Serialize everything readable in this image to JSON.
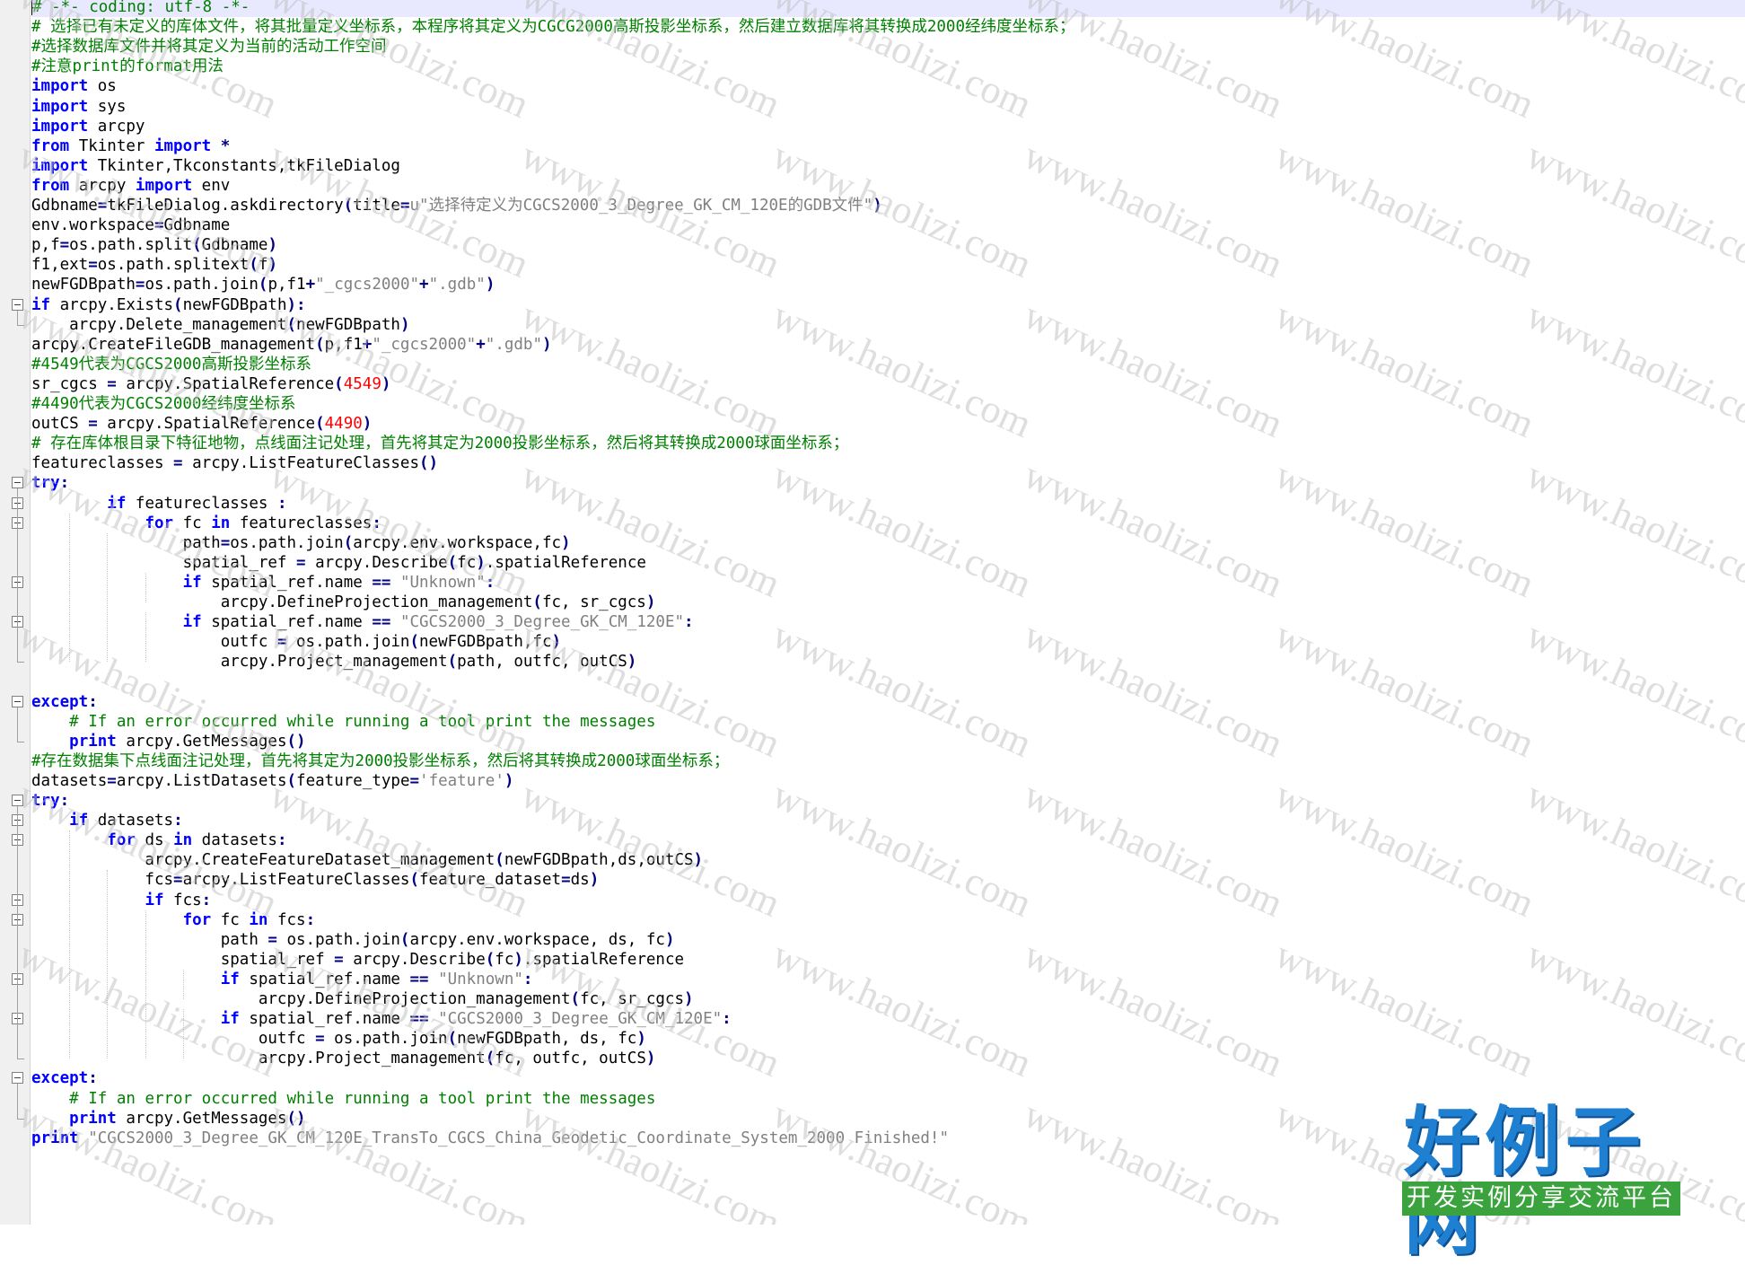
{
  "editor": {
    "language": "python",
    "lines": [
      [
        {
          "t": "cm",
          "v": "# -*- coding: utf-8 -*-"
        }
      ],
      [
        {
          "t": "cm",
          "v": "# 选择已有未定义的库体文件，将其批量定义坐标系，本程序将其定义为CGCG2000高斯投影坐标系，然后建立数据库将其转换成2000经纬度坐标系；"
        }
      ],
      [
        {
          "t": "cm",
          "v": "#选择数据库文件并将其定义为当前的活动工作空间"
        }
      ],
      [
        {
          "t": "cm",
          "v": "#注意print的format用法"
        }
      ],
      [
        {
          "t": "kw",
          "v": "import"
        },
        {
          "t": "tx",
          "v": " os"
        }
      ],
      [
        {
          "t": "kw",
          "v": "import"
        },
        {
          "t": "tx",
          "v": " sys"
        }
      ],
      [
        {
          "t": "kw",
          "v": "import"
        },
        {
          "t": "tx",
          "v": " arcpy"
        }
      ],
      [
        {
          "t": "kw",
          "v": "from"
        },
        {
          "t": "tx",
          "v": " Tkinter "
        },
        {
          "t": "kw",
          "v": "import"
        },
        {
          "t": "op",
          "v": " *"
        }
      ],
      [
        {
          "t": "kw",
          "v": "import"
        },
        {
          "t": "tx",
          "v": " Tkinter,Tkconstants,tkFileDialog"
        }
      ],
      [
        {
          "t": "kw",
          "v": "from"
        },
        {
          "t": "tx",
          "v": " arcpy "
        },
        {
          "t": "kw",
          "v": "import"
        },
        {
          "t": "tx",
          "v": " env"
        }
      ],
      [
        {
          "t": "tx",
          "v": "Gdbname"
        },
        {
          "t": "op",
          "v": "="
        },
        {
          "t": "tx",
          "v": "tkFileDialog.askdirectory"
        },
        {
          "t": "op",
          "v": "("
        },
        {
          "t": "tx",
          "v": "title"
        },
        {
          "t": "op",
          "v": "="
        },
        {
          "t": "st",
          "v": "u\"选择待定义为CGCS2000_3_Degree_GK_CM_120E的GDB文件\""
        },
        {
          "t": "op",
          "v": ")"
        }
      ],
      [
        {
          "t": "tx",
          "v": "env.workspace"
        },
        {
          "t": "op",
          "v": "="
        },
        {
          "t": "tx",
          "v": "Gdbname"
        }
      ],
      [
        {
          "t": "tx",
          "v": "p,f"
        },
        {
          "t": "op",
          "v": "="
        },
        {
          "t": "tx",
          "v": "os.path.split"
        },
        {
          "t": "op",
          "v": "("
        },
        {
          "t": "tx",
          "v": "Gdbname"
        },
        {
          "t": "op",
          "v": ")"
        }
      ],
      [
        {
          "t": "tx",
          "v": "f1,ext"
        },
        {
          "t": "op",
          "v": "="
        },
        {
          "t": "tx",
          "v": "os.path.splitext"
        },
        {
          "t": "op",
          "v": "("
        },
        {
          "t": "tx",
          "v": "f"
        },
        {
          "t": "op",
          "v": ")"
        }
      ],
      [
        {
          "t": "tx",
          "v": "newFGDBpath"
        },
        {
          "t": "op",
          "v": "="
        },
        {
          "t": "tx",
          "v": "os.path.join"
        },
        {
          "t": "op",
          "v": "("
        },
        {
          "t": "tx",
          "v": "p,f1"
        },
        {
          "t": "op",
          "v": "+"
        },
        {
          "t": "st",
          "v": "\"_cgcs2000\""
        },
        {
          "t": "op",
          "v": "+"
        },
        {
          "t": "st",
          "v": "\".gdb\""
        },
        {
          "t": "op",
          "v": ")"
        }
      ],
      [
        {
          "t": "kw",
          "v": "if"
        },
        {
          "t": "tx",
          "v": " arcpy.Exists"
        },
        {
          "t": "op",
          "v": "("
        },
        {
          "t": "tx",
          "v": "newFGDBpath"
        },
        {
          "t": "op",
          "v": "):"
        }
      ],
      [
        {
          "t": "tx",
          "v": "    arcpy.Delete_management"
        },
        {
          "t": "op",
          "v": "("
        },
        {
          "t": "tx",
          "v": "newFGDBpath"
        },
        {
          "t": "op",
          "v": ")"
        }
      ],
      [
        {
          "t": "tx",
          "v": "arcpy.CreateFileGDB_management"
        },
        {
          "t": "op",
          "v": "("
        },
        {
          "t": "tx",
          "v": "p,f1"
        },
        {
          "t": "op",
          "v": "+"
        },
        {
          "t": "st",
          "v": "\"_cgcs2000\""
        },
        {
          "t": "op",
          "v": "+"
        },
        {
          "t": "st",
          "v": "\".gdb\""
        },
        {
          "t": "op",
          "v": ")"
        }
      ],
      [
        {
          "t": "cm",
          "v": "#4549代表为CGCS2000高斯投影坐标系"
        }
      ],
      [
        {
          "t": "tx",
          "v": "sr_cgcs "
        },
        {
          "t": "op",
          "v": "="
        },
        {
          "t": "tx",
          "v": " arcpy.SpatialReference"
        },
        {
          "t": "op",
          "v": "("
        },
        {
          "t": "nm",
          "v": "4549"
        },
        {
          "t": "op",
          "v": ")"
        }
      ],
      [
        {
          "t": "cm",
          "v": "#4490代表为CGCS2000经纬度坐标系"
        }
      ],
      [
        {
          "t": "tx",
          "v": "outCS "
        },
        {
          "t": "op",
          "v": "="
        },
        {
          "t": "tx",
          "v": " arcpy.SpatialReference"
        },
        {
          "t": "op",
          "v": "("
        },
        {
          "t": "nm",
          "v": "4490"
        },
        {
          "t": "op",
          "v": ")"
        }
      ],
      [
        {
          "t": "cm",
          "v": "# 存在库体根目录下特征地物，点线面注记处理，首先将其定为2000投影坐标系，然后将其转换成2000球面坐标系；"
        }
      ],
      [
        {
          "t": "tx",
          "v": "featureclasses "
        },
        {
          "t": "op",
          "v": "="
        },
        {
          "t": "tx",
          "v": " arcpy.ListFeatureClasses"
        },
        {
          "t": "op",
          "v": "()"
        }
      ],
      [
        {
          "t": "kw",
          "v": "try"
        },
        {
          "t": "op",
          "v": ":"
        }
      ],
      [
        {
          "t": "tx",
          "v": "        "
        },
        {
          "t": "kw",
          "v": "if"
        },
        {
          "t": "tx",
          "v": " featureclasses "
        },
        {
          "t": "op",
          "v": ":"
        }
      ],
      [
        {
          "t": "tx",
          "v": "            "
        },
        {
          "t": "kw",
          "v": "for"
        },
        {
          "t": "tx",
          "v": " fc "
        },
        {
          "t": "kw",
          "v": "in"
        },
        {
          "t": "tx",
          "v": " featureclasses"
        },
        {
          "t": "op",
          "v": ":"
        }
      ],
      [
        {
          "t": "tx",
          "v": "                path"
        },
        {
          "t": "op",
          "v": "="
        },
        {
          "t": "tx",
          "v": "os.path.join"
        },
        {
          "t": "op",
          "v": "("
        },
        {
          "t": "tx",
          "v": "arcpy.env.workspace,fc"
        },
        {
          "t": "op",
          "v": ")"
        }
      ],
      [
        {
          "t": "tx",
          "v": "                spatial_ref "
        },
        {
          "t": "op",
          "v": "="
        },
        {
          "t": "tx",
          "v": " arcpy.Describe"
        },
        {
          "t": "op",
          "v": "("
        },
        {
          "t": "tx",
          "v": "fc"
        },
        {
          "t": "op",
          "v": ")"
        },
        {
          "t": "tx",
          "v": ".spatialReference"
        }
      ],
      [
        {
          "t": "tx",
          "v": "                "
        },
        {
          "t": "kw",
          "v": "if"
        },
        {
          "t": "tx",
          "v": " spatial_ref.name "
        },
        {
          "t": "op",
          "v": "=="
        },
        {
          "t": "tx",
          "v": " "
        },
        {
          "t": "st",
          "v": "\"Unknown\""
        },
        {
          "t": "op",
          "v": ":"
        }
      ],
      [
        {
          "t": "tx",
          "v": "                    arcpy.DefineProjection_management"
        },
        {
          "t": "op",
          "v": "("
        },
        {
          "t": "tx",
          "v": "fc, sr_cgcs"
        },
        {
          "t": "op",
          "v": ")"
        }
      ],
      [
        {
          "t": "tx",
          "v": "                "
        },
        {
          "t": "kw",
          "v": "if"
        },
        {
          "t": "tx",
          "v": " spatial_ref.name "
        },
        {
          "t": "op",
          "v": "=="
        },
        {
          "t": "tx",
          "v": " "
        },
        {
          "t": "st",
          "v": "\"CGCS2000_3_Degree_GK_CM_120E\""
        },
        {
          "t": "op",
          "v": ":"
        }
      ],
      [
        {
          "t": "tx",
          "v": "                    outfc "
        },
        {
          "t": "op",
          "v": "="
        },
        {
          "t": "tx",
          "v": " os.path.join"
        },
        {
          "t": "op",
          "v": "("
        },
        {
          "t": "tx",
          "v": "newFGDBpath,fc"
        },
        {
          "t": "op",
          "v": ")"
        }
      ],
      [
        {
          "t": "tx",
          "v": "                    arcpy.Project_management"
        },
        {
          "t": "op",
          "v": "("
        },
        {
          "t": "tx",
          "v": "path, outfc, outCS"
        },
        {
          "t": "op",
          "v": ")"
        }
      ],
      [],
      [
        {
          "t": "kw",
          "v": "except"
        },
        {
          "t": "op",
          "v": ":"
        }
      ],
      [
        {
          "t": "tx",
          "v": "    "
        },
        {
          "t": "cm",
          "v": "# If an error occurred while running a tool print the messages"
        }
      ],
      [
        {
          "t": "tx",
          "v": "    "
        },
        {
          "t": "kw",
          "v": "print"
        },
        {
          "t": "tx",
          "v": " arcpy.GetMessages"
        },
        {
          "t": "op",
          "v": "()"
        }
      ],
      [
        {
          "t": "cm",
          "v": "#存在数据集下点线面注记处理，首先将其定为2000投影坐标系，然后将其转换成2000球面坐标系；"
        }
      ],
      [
        {
          "t": "tx",
          "v": "datasets"
        },
        {
          "t": "op",
          "v": "="
        },
        {
          "t": "tx",
          "v": "arcpy.ListDatasets"
        },
        {
          "t": "op",
          "v": "("
        },
        {
          "t": "tx",
          "v": "feature_type"
        },
        {
          "t": "op",
          "v": "="
        },
        {
          "t": "st",
          "v": "'feature'"
        },
        {
          "t": "op",
          "v": ")"
        }
      ],
      [
        {
          "t": "kw",
          "v": "try"
        },
        {
          "t": "op",
          "v": ":"
        }
      ],
      [
        {
          "t": "tx",
          "v": "    "
        },
        {
          "t": "kw",
          "v": "if"
        },
        {
          "t": "tx",
          "v": " datasets"
        },
        {
          "t": "op",
          "v": ":"
        }
      ],
      [
        {
          "t": "tx",
          "v": "        "
        },
        {
          "t": "kw",
          "v": "for"
        },
        {
          "t": "tx",
          "v": " ds "
        },
        {
          "t": "kw",
          "v": "in"
        },
        {
          "t": "tx",
          "v": " datasets"
        },
        {
          "t": "op",
          "v": ":"
        }
      ],
      [
        {
          "t": "tx",
          "v": "            arcpy.CreateFeatureDataset_management"
        },
        {
          "t": "op",
          "v": "("
        },
        {
          "t": "tx",
          "v": "newFGDBpath,ds,outCS"
        },
        {
          "t": "op",
          "v": ")"
        }
      ],
      [
        {
          "t": "tx",
          "v": "            fcs"
        },
        {
          "t": "op",
          "v": "="
        },
        {
          "t": "tx",
          "v": "arcpy.ListFeatureClasses"
        },
        {
          "t": "op",
          "v": "("
        },
        {
          "t": "tx",
          "v": "feature_dataset"
        },
        {
          "t": "op",
          "v": "="
        },
        {
          "t": "tx",
          "v": "ds"
        },
        {
          "t": "op",
          "v": ")"
        }
      ],
      [
        {
          "t": "tx",
          "v": "            "
        },
        {
          "t": "kw",
          "v": "if"
        },
        {
          "t": "tx",
          "v": " fcs"
        },
        {
          "t": "op",
          "v": ":"
        }
      ],
      [
        {
          "t": "tx",
          "v": "                "
        },
        {
          "t": "kw",
          "v": "for"
        },
        {
          "t": "tx",
          "v": " fc "
        },
        {
          "t": "kw",
          "v": "in"
        },
        {
          "t": "tx",
          "v": " fcs"
        },
        {
          "t": "op",
          "v": ":"
        }
      ],
      [
        {
          "t": "tx",
          "v": "                    path "
        },
        {
          "t": "op",
          "v": "="
        },
        {
          "t": "tx",
          "v": " os.path.join"
        },
        {
          "t": "op",
          "v": "("
        },
        {
          "t": "tx",
          "v": "arcpy.env.workspace, ds, fc"
        },
        {
          "t": "op",
          "v": ")"
        }
      ],
      [
        {
          "t": "tx",
          "v": "                    spatial_ref "
        },
        {
          "t": "op",
          "v": "="
        },
        {
          "t": "tx",
          "v": " arcpy.Describe"
        },
        {
          "t": "op",
          "v": "("
        },
        {
          "t": "tx",
          "v": "fc"
        },
        {
          "t": "op",
          "v": ")"
        },
        {
          "t": "tx",
          "v": ".spatialReference"
        }
      ],
      [
        {
          "t": "tx",
          "v": "                    "
        },
        {
          "t": "kw",
          "v": "if"
        },
        {
          "t": "tx",
          "v": " spatial_ref.name "
        },
        {
          "t": "op",
          "v": "=="
        },
        {
          "t": "tx",
          "v": " "
        },
        {
          "t": "st",
          "v": "\"Unknown\""
        },
        {
          "t": "op",
          "v": ":"
        }
      ],
      [
        {
          "t": "tx",
          "v": "                        arcpy.DefineProjection_management"
        },
        {
          "t": "op",
          "v": "("
        },
        {
          "t": "tx",
          "v": "fc, sr_cgcs"
        },
        {
          "t": "op",
          "v": ")"
        }
      ],
      [
        {
          "t": "tx",
          "v": "                    "
        },
        {
          "t": "kw",
          "v": "if"
        },
        {
          "t": "tx",
          "v": " spatial_ref.name "
        },
        {
          "t": "op",
          "v": "=="
        },
        {
          "t": "tx",
          "v": " "
        },
        {
          "t": "st",
          "v": "\"CGCS2000_3_Degree_GK_CM_120E\""
        },
        {
          "t": "op",
          "v": ":"
        }
      ],
      [
        {
          "t": "tx",
          "v": "                        outfc "
        },
        {
          "t": "op",
          "v": "="
        },
        {
          "t": "tx",
          "v": " os.path.join"
        },
        {
          "t": "op",
          "v": "("
        },
        {
          "t": "tx",
          "v": "newFGDBpath, ds, fc"
        },
        {
          "t": "op",
          "v": ")"
        }
      ],
      [
        {
          "t": "tx",
          "v": "                        arcpy.Project_management"
        },
        {
          "t": "op",
          "v": "("
        },
        {
          "t": "tx",
          "v": "fc, outfc, outCS"
        },
        {
          "t": "op",
          "v": ")"
        }
      ],
      [
        {
          "t": "kw",
          "v": "except"
        },
        {
          "t": "op",
          "v": ":"
        }
      ],
      [
        {
          "t": "tx",
          "v": "    "
        },
        {
          "t": "cm",
          "v": "# If an error occurred while running a tool print the messages"
        }
      ],
      [
        {
          "t": "tx",
          "v": "    "
        },
        {
          "t": "kw",
          "v": "print"
        },
        {
          "t": "tx",
          "v": " arcpy.GetMessages"
        },
        {
          "t": "op",
          "v": "()"
        }
      ],
      [
        {
          "t": "kw",
          "v": "print"
        },
        {
          "t": "tx",
          "v": " "
        },
        {
          "t": "st",
          "v": "\"CGCS2000_3_Degree_GK_CM_120E_TransTo_CGCS_China_Geodetic_Coordinate_System_2000 Finished!\""
        }
      ]
    ]
  },
  "watermark": {
    "text": "www.haolizi.com",
    "logo_title": "好例子网",
    "logo_subtitle": "开发实例分享交流平台"
  },
  "colors": {
    "keyword": "#0000ff",
    "comment": "#008000",
    "string": "#808080",
    "number": "#ff0000",
    "current_line": "#e8e8ff"
  }
}
